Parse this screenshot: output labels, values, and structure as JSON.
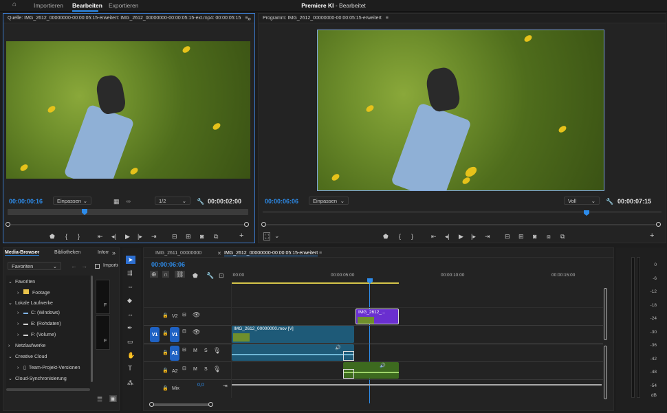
{
  "topbar": {
    "home_icon": "home-icon",
    "nav": [
      "Importieren",
      "Bearbeiten",
      "Exportieren"
    ],
    "title_app": "Premiere KI",
    "title_sep": " - ",
    "title_mode": "Bearbeitet"
  },
  "source": {
    "tab": "Quelle: IMG_2612_00000000-00:00:05:15-erweitert: IMG_2612_00000000-00:00:05:15-ext.mp4: 00:00:05:15",
    "timecode": "00:00:00:16",
    "fit": "Einpassen",
    "resolution": "1/2",
    "duration": "00:00:02:00"
  },
  "program": {
    "tab": "Programm: IMG_2612_00000000-00:00:05:15-erweitert",
    "timecode": "00:00:06:06",
    "fit": "Einpassen",
    "resolution": "Voll",
    "duration": "00:00:07:15"
  },
  "mediabrowser": {
    "tabs": [
      "Media-Browser",
      "Bibliotheken",
      "Inforr"
    ],
    "favorites_dropdown": "Favoriten",
    "import_label": "Importie",
    "tree": [
      {
        "label": "Favoriten",
        "level": 0,
        "expanded": true
      },
      {
        "label": "Footage",
        "level": 1,
        "icon": "folder-icon"
      },
      {
        "label": "Lokale Laufwerke",
        "level": 0,
        "expanded": true
      },
      {
        "label": "C: (Windows)",
        "level": 1,
        "icon": "drive-icon"
      },
      {
        "label": "E: (Rohdaten)",
        "level": 1,
        "icon": "drive-icon"
      },
      {
        "label": "F: (Volume)",
        "level": 1,
        "icon": "drive-icon"
      },
      {
        "label": "Netzlaufwerke",
        "level": 0,
        "expanded": true
      },
      {
        "label": "Creative Cloud",
        "level": 0,
        "expanded": true
      },
      {
        "label": "Team-Projekt-Versionen",
        "level": 1,
        "icon": "team-project-icon"
      },
      {
        "label": "Cloud-Synchronisierung",
        "level": 0,
        "expanded": true
      }
    ],
    "thumb_labels": [
      "F",
      "F"
    ]
  },
  "timeline": {
    "tabs": [
      "IMG_2611_00000000",
      "IMG_2612_00000000-00:00:05:15-erweitert"
    ],
    "timecode": "00:00:06:06",
    "ruler": [
      ":00:00",
      "00:00:05:00",
      "00:00:10:00",
      "00:00:15:00"
    ],
    "tracks": {
      "v2": "V2",
      "v1": "V1",
      "v1_target": "V1",
      "a1": "A1",
      "a2": "A2",
      "mix": "Mix",
      "mix_value": "0,0",
      "m": "M",
      "s": "S"
    },
    "clips": {
      "v2_clip": "IMG_2612_...",
      "v1_clip": "IMG_2612_00000000.mov [V]"
    }
  },
  "meter": {
    "labels": [
      "0",
      "-6",
      "-12",
      "-18",
      "-24",
      "-30",
      "-36",
      "-42",
      "-48",
      "-54",
      "dB"
    ]
  },
  "colors": {
    "accent": "#2d8ceb",
    "video_clip": "#1e5a78",
    "audio_clip": "#3d6a1f",
    "v2_clip": "#6a2fd0"
  }
}
